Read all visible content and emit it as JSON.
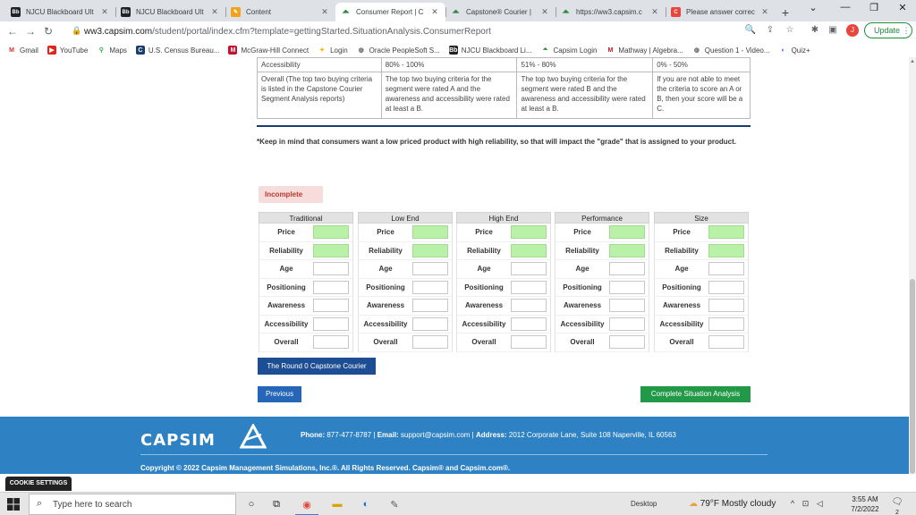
{
  "browser": {
    "tabs": [
      {
        "icon": "blackboard-icon",
        "label": "NJCU Blackboard Ult",
        "active": false
      },
      {
        "icon": "blackboard-icon",
        "label": "NJCU Blackboard Ult",
        "active": false
      },
      {
        "icon": "content-icon",
        "label": "Content",
        "active": false
      },
      {
        "icon": "capsim-icon",
        "label": "Consumer Report | C",
        "active": true
      },
      {
        "icon": "capsim-icon",
        "label": "Capstone® Courier |",
        "active": false
      },
      {
        "icon": "capsim-icon",
        "label": "https://ww3.capsim.c",
        "active": false
      },
      {
        "icon": "c-icon",
        "label": "Please answer correc",
        "active": false
      }
    ],
    "url_host": "ww3.capsim.com",
    "url_path": "/student/portal/index.cfm?template=gettingStarted.SituationAnalysis.ConsumerReport",
    "profile_initial": "J",
    "update_label": "Update",
    "bookmarks": [
      {
        "icon": "gmail-icon",
        "label": "Gmail"
      },
      {
        "icon": "youtube-icon",
        "label": "YouTube"
      },
      {
        "icon": "maps-icon",
        "label": "Maps"
      },
      {
        "icon": "census-icon",
        "label": "U.S. Census Bureau..."
      },
      {
        "icon": "mcgraw-icon",
        "label": "McGraw-Hill Connect"
      },
      {
        "icon": "login-icon",
        "label": "Login"
      },
      {
        "icon": "globe-icon",
        "label": "Oracle PeopleSoft S..."
      },
      {
        "icon": "blackboard-icon",
        "label": "NJCU Blackboard Li..."
      },
      {
        "icon": "capsim-icon",
        "label": "Capsim Login"
      },
      {
        "icon": "mathway-icon",
        "label": "Mathway | Algebra..."
      },
      {
        "icon": "globe-icon",
        "label": "Question 1 - Video..."
      },
      {
        "icon": "quiz-icon",
        "label": "Quiz+"
      }
    ]
  },
  "criteria": {
    "accessibility_row": [
      "Accessibility",
      "80% - 100%",
      "51% - 80%",
      "0% - 50%"
    ],
    "overall_row": [
      "Overall (The top two buying criteria is listed in the Capstone Courier Segment Analysis reports)",
      "The top two buying criteria for the segment were rated A and the awareness and accessibility were rated at least a B.",
      "The top two buying criteria for the segment were rated B and the awareness and accessibility were rated at least a B.",
      "If you are not able to meet the criteria to score an A or B, then your score will be a C."
    ]
  },
  "note": "*Keep in mind that consumers want a low priced product with high reliability, so that will impact the \"grade\" that is assigned to your product.",
  "status_badge": "Incomplete",
  "segments": [
    {
      "name": "Traditional"
    },
    {
      "name": "Low End"
    },
    {
      "name": "High End"
    },
    {
      "name": "Performance"
    },
    {
      "name": "Size"
    }
  ],
  "criteria_rows": [
    "Price",
    "Reliability",
    "Age",
    "Positioning",
    "Awareness",
    "Accessibility",
    "Overall"
  ],
  "filled_rows": [
    "Price",
    "Reliability"
  ],
  "buttons": {
    "courier": "The Round 0 Capstone Courier",
    "previous": "Previous",
    "complete": "Complete Situation Analysis"
  },
  "footer": {
    "logo": "CAPSIM",
    "phone_label": "Phone:",
    "phone": "877-477-8787",
    "email_label": "Email:",
    "email": "support@capsim.com",
    "address_label": "Address:",
    "address": "2012 Corporate Lane, Suite 108 Naperville, IL 60563",
    "copyright": "Copyright © 2022 Capsim Management Simulations, Inc.®. All Rights Reserved. Capsim® and Capsim.com®."
  },
  "cookie_label": "COOKIE SETTINGS",
  "taskbar": {
    "search_placeholder": "Type here to search",
    "desktop_label": "Desktop",
    "weather": "79°F  Mostly cloudy",
    "time": "3:55 AM",
    "date": "7/2/2022",
    "notif_count": "2"
  },
  "colors": {
    "filled_box": "#b9f1a8",
    "courier_button": "#1d4e94",
    "complete_button": "#229947",
    "footer": "#2e82c4"
  }
}
